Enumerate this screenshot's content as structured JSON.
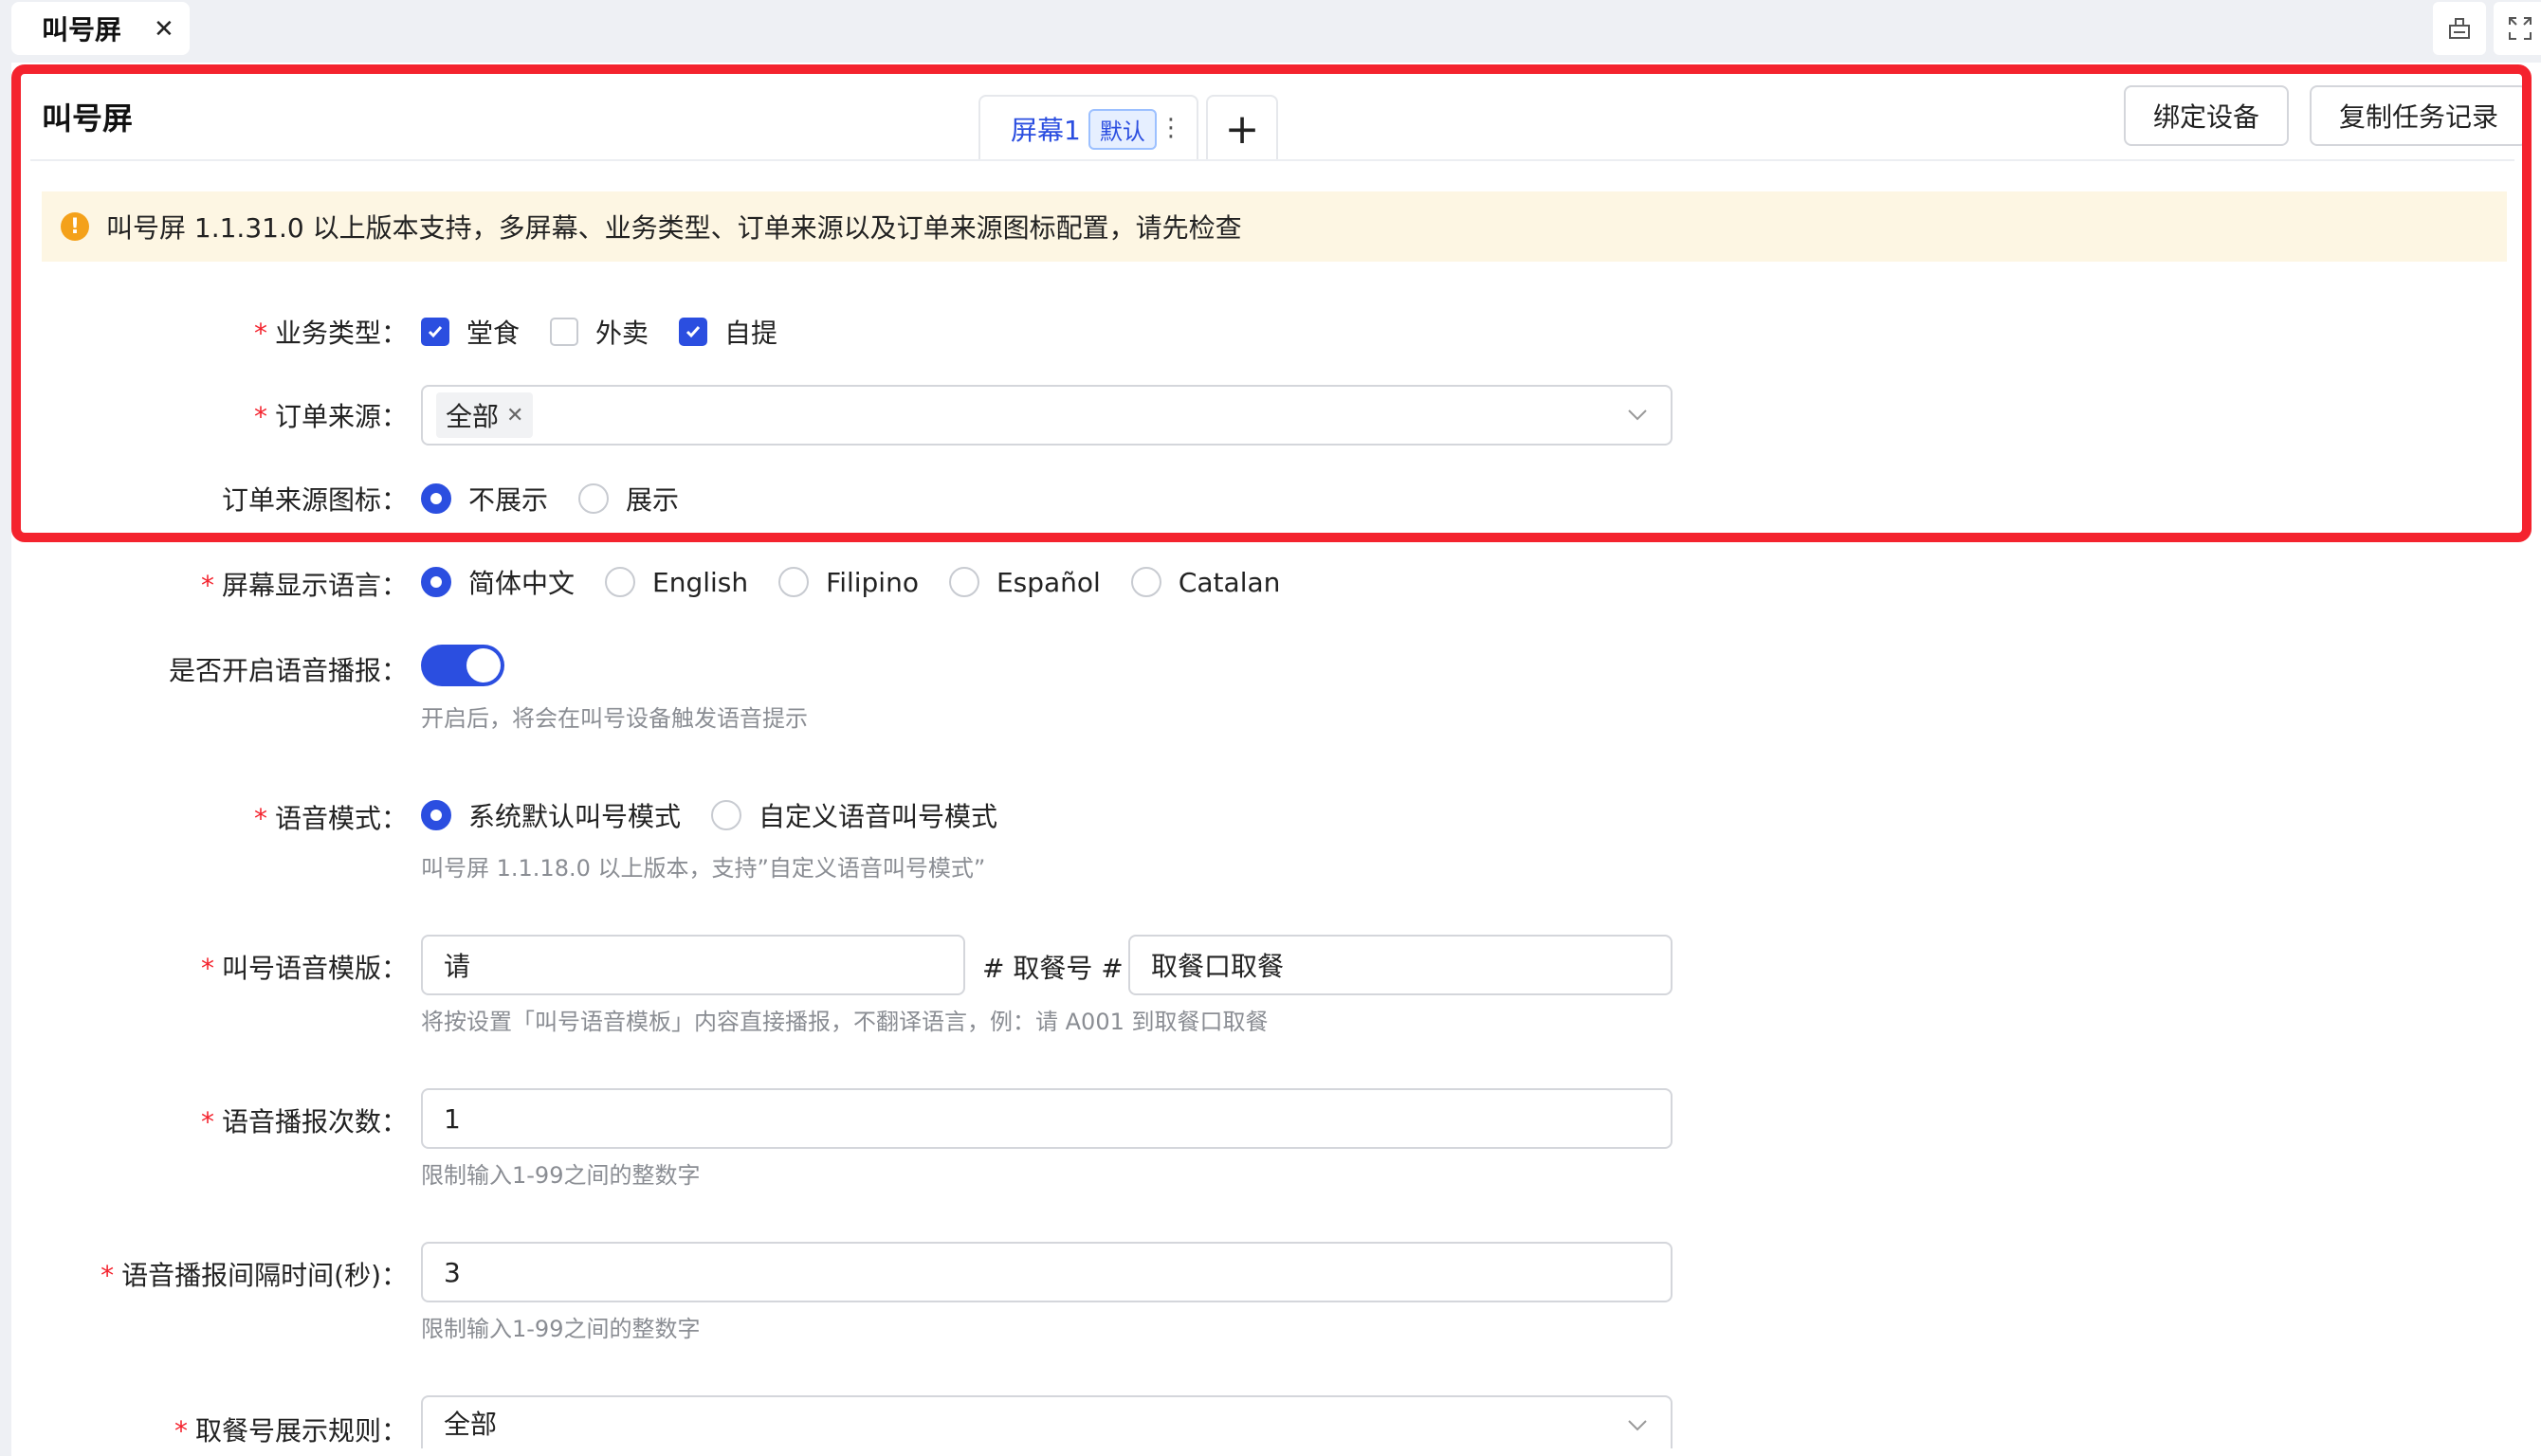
{
  "top_tab": {
    "label": "叫号屏"
  },
  "card": {
    "title": "叫号屏",
    "screen_tab": {
      "label": "屏幕1",
      "badge": "默认"
    },
    "add_tab": "+",
    "buttons": {
      "bind_device": "绑定设备",
      "copy_task": "复制任务记录"
    }
  },
  "alert": {
    "icon": "!",
    "text": "叫号屏 1.1.31.0 以上版本支持，多屏幕、业务类型、订单来源以及订单来源图标配置，请先检查"
  },
  "form": {
    "business_type": {
      "label": "业务类型：",
      "options": [
        {
          "label": "堂食",
          "checked": true
        },
        {
          "label": "外卖",
          "checked": false
        },
        {
          "label": "自提",
          "checked": true
        }
      ]
    },
    "order_source": {
      "label": "订单来源：",
      "tag": "全部"
    },
    "source_icon": {
      "label": "订单来源图标：",
      "options": [
        {
          "label": "不展示",
          "selected": true
        },
        {
          "label": "展示",
          "selected": false
        }
      ]
    },
    "language": {
      "label": "屏幕显示语言：",
      "options": [
        {
          "label": "简体中文",
          "selected": true
        },
        {
          "label": "English",
          "selected": false
        },
        {
          "label": "Filipino",
          "selected": false
        },
        {
          "label": "Español",
          "selected": false
        },
        {
          "label": "Catalan",
          "selected": false
        }
      ]
    },
    "voice_enable": {
      "label": "是否开启语音播报：",
      "on": true,
      "hint": "开启后，将会在叫号设备触发语音提示"
    },
    "voice_mode": {
      "label": "语音模式：",
      "options": [
        {
          "label": "系统默认叫号模式",
          "selected": true
        },
        {
          "label": "自定义语音叫号模式",
          "selected": false
        }
      ],
      "hint": "叫号屏 1.1.18.0 以上版本，支持”自定义语音叫号模式”"
    },
    "voice_template": {
      "label": "叫号语音模版：",
      "prefix": "请",
      "middle": "# 取餐号 #",
      "suffix": "取餐口取餐",
      "hint": "将按设置「叫号语音模板」内容直接播报，不翻译语言，例：请 A001 到取餐口取餐"
    },
    "repeat_count": {
      "label": "语音播报次数：",
      "value": "1",
      "hint": "限制输入1-99之间的整数字"
    },
    "interval": {
      "label": "语音播报间隔时间(秒)：",
      "value": "3",
      "hint": "限制输入1-99之间的整数字"
    },
    "display_rule": {
      "label": "取餐号展示规则：",
      "value": "全部"
    }
  },
  "colors": {
    "accent": "#2b4ee0",
    "highlight": "#f4232e",
    "alert_bg": "#fdf6e3",
    "alert_icon": "#f4a11a"
  }
}
